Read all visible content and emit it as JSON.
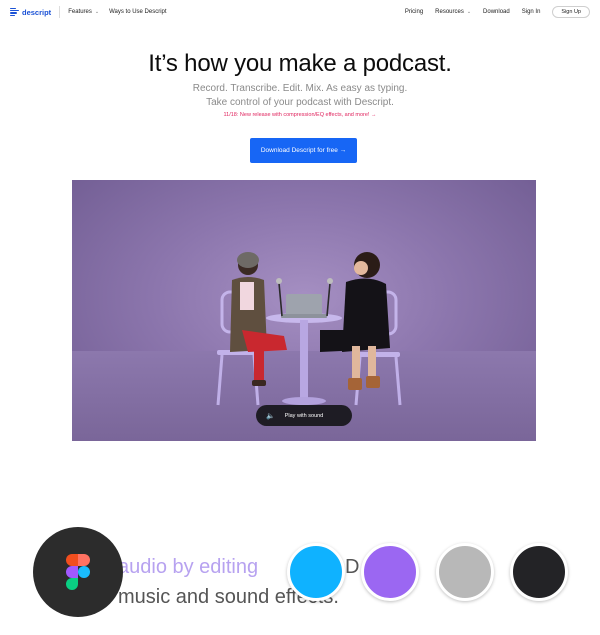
{
  "nav": {
    "brand": "descript",
    "features": "Features",
    "ways": "Ways to Use Descript",
    "pricing": "Pricing",
    "resources": "Resources",
    "download": "Download",
    "signin": "Sign In",
    "signup": "Sign Up",
    "chevron": "⌄"
  },
  "hero": {
    "title": "It’s how you make a podcast.",
    "subtitle1": "Record. Transcribe. Edit. Mix. As easy as typing.",
    "subtitle2": "Take control of your podcast with Descript.",
    "promo": "11/18: New release with compression/EQ effects, and more! →",
    "cta": "Download Descript for free →"
  },
  "video": {
    "play_label": "Play with sound",
    "speaker_icon": "🔈"
  },
  "bottom": {
    "line1a": "audio by editing",
    "line1b": "D      nd      t",
    "line2": "music and sound effects."
  },
  "swatches": [
    {
      "name": "swatch-blue",
      "color": "#0fb2ff"
    },
    {
      "name": "swatch-purple",
      "color": "#9b67f2"
    },
    {
      "name": "swatch-gray",
      "color": "#b8b8b8"
    },
    {
      "name": "swatch-black",
      "color": "#232326"
    }
  ],
  "figma_colors": {
    "red": "#f24e1e",
    "orange": "#ff7262",
    "purple": "#a259ff",
    "blue": "#1abcfe",
    "green": "#0acf83"
  }
}
